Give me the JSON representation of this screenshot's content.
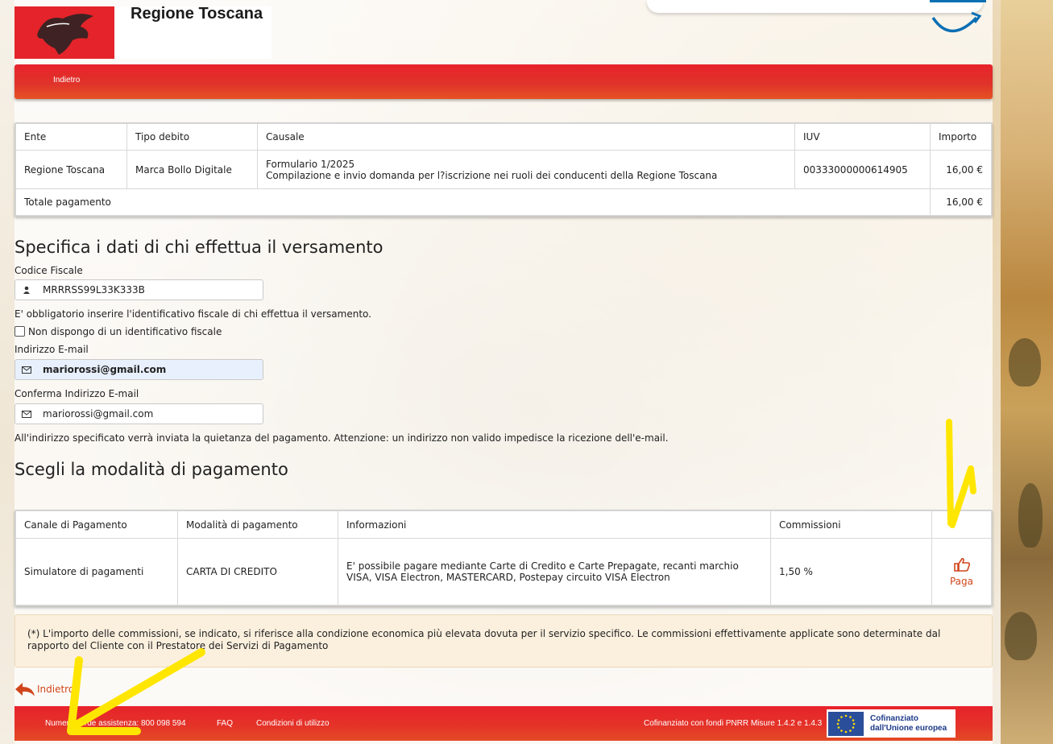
{
  "header": {
    "brand": "Regione Toscana",
    "back_label": "Indietro"
  },
  "debt_table": {
    "headers": [
      "Ente",
      "Tipo debito",
      "Causale",
      "IUV",
      "Importo"
    ],
    "row": {
      "ente": "Regione Toscana",
      "tipo": "Marca Bollo Digitale",
      "causale_line1": "Formulario 1/2025",
      "causale_line2": "Compilazione e invio domanda per l?iscrizione nei ruoli dei conducenti della Regione Toscana",
      "iuv": "00333000000614905",
      "importo": "16,00 €"
    },
    "total_label": "Totale pagamento",
    "total_value": "16,00 €"
  },
  "payer": {
    "title": "Specifica i dati di chi effettua il versamento",
    "cf_label": "Codice Fiscale",
    "cf_value": "MRRRSS99L33K333B",
    "cf_help": "E' obbligatorio inserire l'identificativo fiscale di chi effettua il versamento.",
    "no_cf_label": "Non dispongo di un identificativo fiscale",
    "email_label": "Indirizzo E-mail",
    "email_value": "mariorossi@gmail.com",
    "email_confirm_label": "Conferma Indirizzo E-mail",
    "email_confirm_value": "mariorossi@gmail.com",
    "email_help": "All'indirizzo specificato verrà inviata la quietanza del pagamento. Attenzione: un indirizzo non valido impedisce la ricezione dell'e-mail."
  },
  "payment": {
    "title": "Scegli la modalità di pagamento",
    "headers": [
      "Canale di Pagamento",
      "Modalità di pagamento",
      "Informazioni",
      "Commissioni"
    ],
    "row": {
      "canale": "Simulatore di pagamenti",
      "modalita": "CARTA DI CREDITO",
      "info": "E' possibile pagare mediante Carte di Credito e Carte Prepagate, recanti marchio VISA, VISA Electron, MASTERCARD, Postepay circuito VISA Electron",
      "commissioni": "1,50 %",
      "action": "Paga"
    }
  },
  "note": "(*) L'importo delle commissioni, se indicato, si riferisce alla condizione economica più elevata dovuta per il servizio specifico. Le commissioni effettivamente applicate sono determinate dal rapporto del Cliente con il Prestatore dei Servizi di Pagamento",
  "bottom_back": "Indietro",
  "footer": {
    "helpline": "Numero verde assistenza: 800 098 594",
    "faq": "FAQ",
    "terms": "Condizioni di utilizzo",
    "funding": "Cofinanziato con fondi PNRR Misure 1.4.2 e 1.4.3",
    "eu_line1": "Cofinanziato",
    "eu_line2": "dall'Unione europea"
  },
  "colors": {
    "brand_red": "#e4242a",
    "action_orange": "#d0451b",
    "highlight_yellow": "#ffe600"
  }
}
